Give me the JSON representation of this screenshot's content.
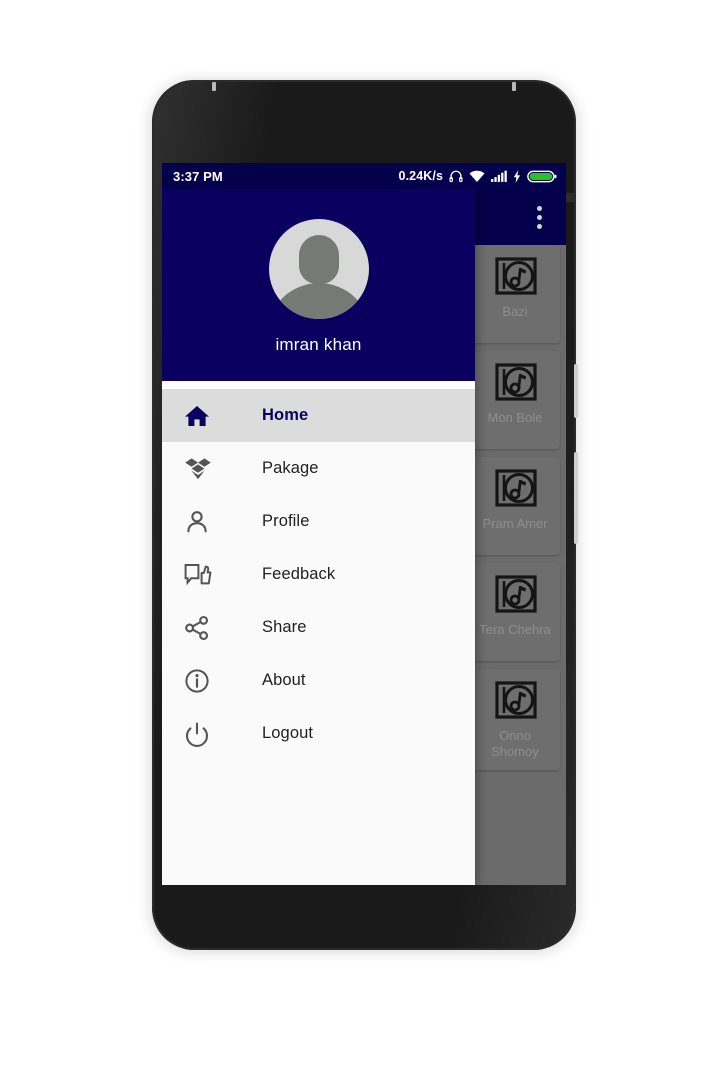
{
  "device": {
    "label": "android-phone-mockup"
  },
  "status_bar": {
    "time": "3:37 PM",
    "data_rate": "0.24K/s",
    "icons": [
      "headphone-icon",
      "wifi-icon",
      "signal-icon",
      "charging-bolt-icon",
      "battery-icon"
    ]
  },
  "app_bar": {
    "overflow_label": "overflow-menu"
  },
  "drawer": {
    "user_name": "imran khan",
    "avatar_label": "default-user-avatar",
    "items": [
      {
        "label": "Home",
        "icon": "home-icon",
        "selected": true
      },
      {
        "label": "Pakage",
        "icon": "package-icon",
        "selected": false
      },
      {
        "label": "Profile",
        "icon": "person-icon",
        "selected": false
      },
      {
        "label": "Feedback",
        "icon": "feedback-icon",
        "selected": false
      },
      {
        "label": "Share",
        "icon": "share-icon",
        "selected": false
      },
      {
        "label": "About",
        "icon": "info-icon",
        "selected": false
      },
      {
        "label": "Logout",
        "icon": "power-icon",
        "selected": false
      }
    ]
  },
  "song_list": {
    "items": [
      {
        "title": "Bazi",
        "icon": "album-music-icon"
      },
      {
        "title": "Mon Bole",
        "icon": "album-music-icon"
      },
      {
        "title": "Pram Amer",
        "icon": "album-music-icon"
      },
      {
        "title": "Tera Chehra",
        "icon": "album-music-icon"
      },
      {
        "title": "Onno Shomoy",
        "icon": "album-music-icon"
      }
    ]
  },
  "colors": {
    "primary_navy": "#0a0060",
    "statusbar_navy": "#05004b",
    "scrim_gray": "#6b6b6b",
    "drawer_bg": "#fafafa",
    "selected_row": "#dcdcdc",
    "battery_green": "#27c227"
  }
}
